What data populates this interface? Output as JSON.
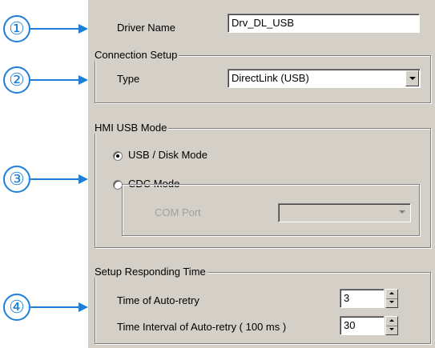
{
  "callouts": [
    "①",
    "②",
    "③",
    "④"
  ],
  "driver": {
    "label": "Driver Name",
    "value": "Drv_DL_USB"
  },
  "connection": {
    "group_title": "Connection Setup",
    "type_label": "Type",
    "type_value": "DirectLink (USB)"
  },
  "hmi_usb_mode": {
    "group_title": "HMI USB Mode",
    "options": [
      {
        "label": "USB / Disk Mode",
        "selected": true
      },
      {
        "label": "CDC Mode",
        "selected": false
      }
    ],
    "com_port_label": "COM Port",
    "com_port_value": ""
  },
  "responding_time": {
    "group_title": "Setup Responding Time",
    "auto_retry_label": "Time of Auto-retry",
    "auto_retry_value": "3",
    "interval_label": "Time Interval of Auto-retry ( 100 ms )",
    "interval_value": "30"
  },
  "colors": {
    "callout": "#1e7fd8",
    "panel": "#d4d0c8"
  }
}
